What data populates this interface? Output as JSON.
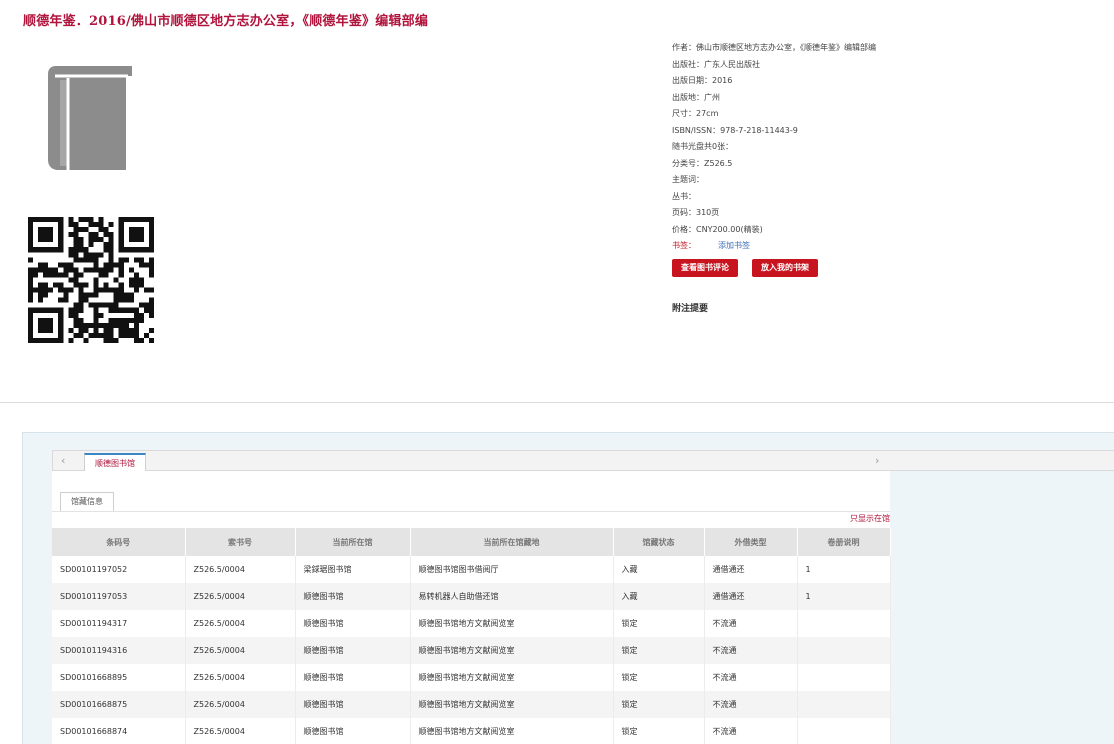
{
  "title": "顺德年鉴．2016/佛山市顺德区地方志办公室，《顺德年鉴》编辑部编",
  "icons": {
    "cover": "book-icon",
    "qr": "qr-code",
    "prev": "chevron-left-icon",
    "next": "chevron-right-icon"
  },
  "colors": {
    "accent": "#b0143c",
    "button": "#c8141e",
    "link": "#3b6fb6"
  },
  "meta": [
    {
      "label": "作者：",
      "value": "佛山市顺德区地方志办公室，《顺德年鉴》编辑部编"
    },
    {
      "label": "出版社：",
      "value": "广东人民出版社"
    },
    {
      "label": "出版日期：",
      "value": "2016"
    },
    {
      "label": "出版地：",
      "value": "广州"
    },
    {
      "label": "尺寸：",
      "value": "27cm"
    },
    {
      "label": "ISBN/ISSN：",
      "value": "978-7-218-11443-9"
    },
    {
      "label": "随书光盘共0张：",
      "value": ""
    },
    {
      "label": "分类号：",
      "value": "Z526.5"
    },
    {
      "label": "主题词：",
      "value": ""
    },
    {
      "label": "丛书：",
      "value": ""
    },
    {
      "label": "页码：",
      "value": "310页"
    },
    {
      "label": "价格：",
      "value": "CNY200.00(精装)"
    }
  ],
  "tags": {
    "label": "书签：",
    "add": "添加书签"
  },
  "buttons": {
    "review": "查看图书评论",
    "shelf": "放入我的书架"
  },
  "notes_title": "附注提要",
  "library_tab": "顺德图书馆",
  "holdings_tab": "馆藏信息",
  "only_show": "只显示在馆",
  "table": {
    "headers": [
      "条码号",
      "索书号",
      "当前所在馆",
      "当前所在馆藏地",
      "馆藏状态",
      "外借类型",
      "卷册说明"
    ],
    "rows": [
      [
        "SD00101197052",
        "Z526.5/0004",
        "梁銶琚图书馆",
        "顺德图书馆图书借阅厅",
        "入藏",
        "通借通还",
        "1"
      ],
      [
        "SD00101197053",
        "Z526.5/0004",
        "顺德图书馆",
        "易转机器人自助借还馆",
        "入藏",
        "通借通还",
        "1"
      ],
      [
        "SD00101194317",
        "Z526.5/0004",
        "顺德图书馆",
        "顺德图书馆地方文献阅览室",
        "锁定",
        "不流通",
        ""
      ],
      [
        "SD00101194316",
        "Z526.5/0004",
        "顺德图书馆",
        "顺德图书馆地方文献阅览室",
        "锁定",
        "不流通",
        ""
      ],
      [
        "SD00101668895",
        "Z526.5/0004",
        "顺德图书馆",
        "顺德图书馆地方文献阅览室",
        "锁定",
        "不流通",
        ""
      ],
      [
        "SD00101668875",
        "Z526.5/0004",
        "顺德图书馆",
        "顺德图书馆地方文献阅览室",
        "锁定",
        "不流通",
        ""
      ],
      [
        "SD00101668874",
        "Z526.5/0004",
        "顺德图书馆",
        "顺德图书馆地方文献阅览室",
        "锁定",
        "不流通",
        ""
      ]
    ]
  }
}
